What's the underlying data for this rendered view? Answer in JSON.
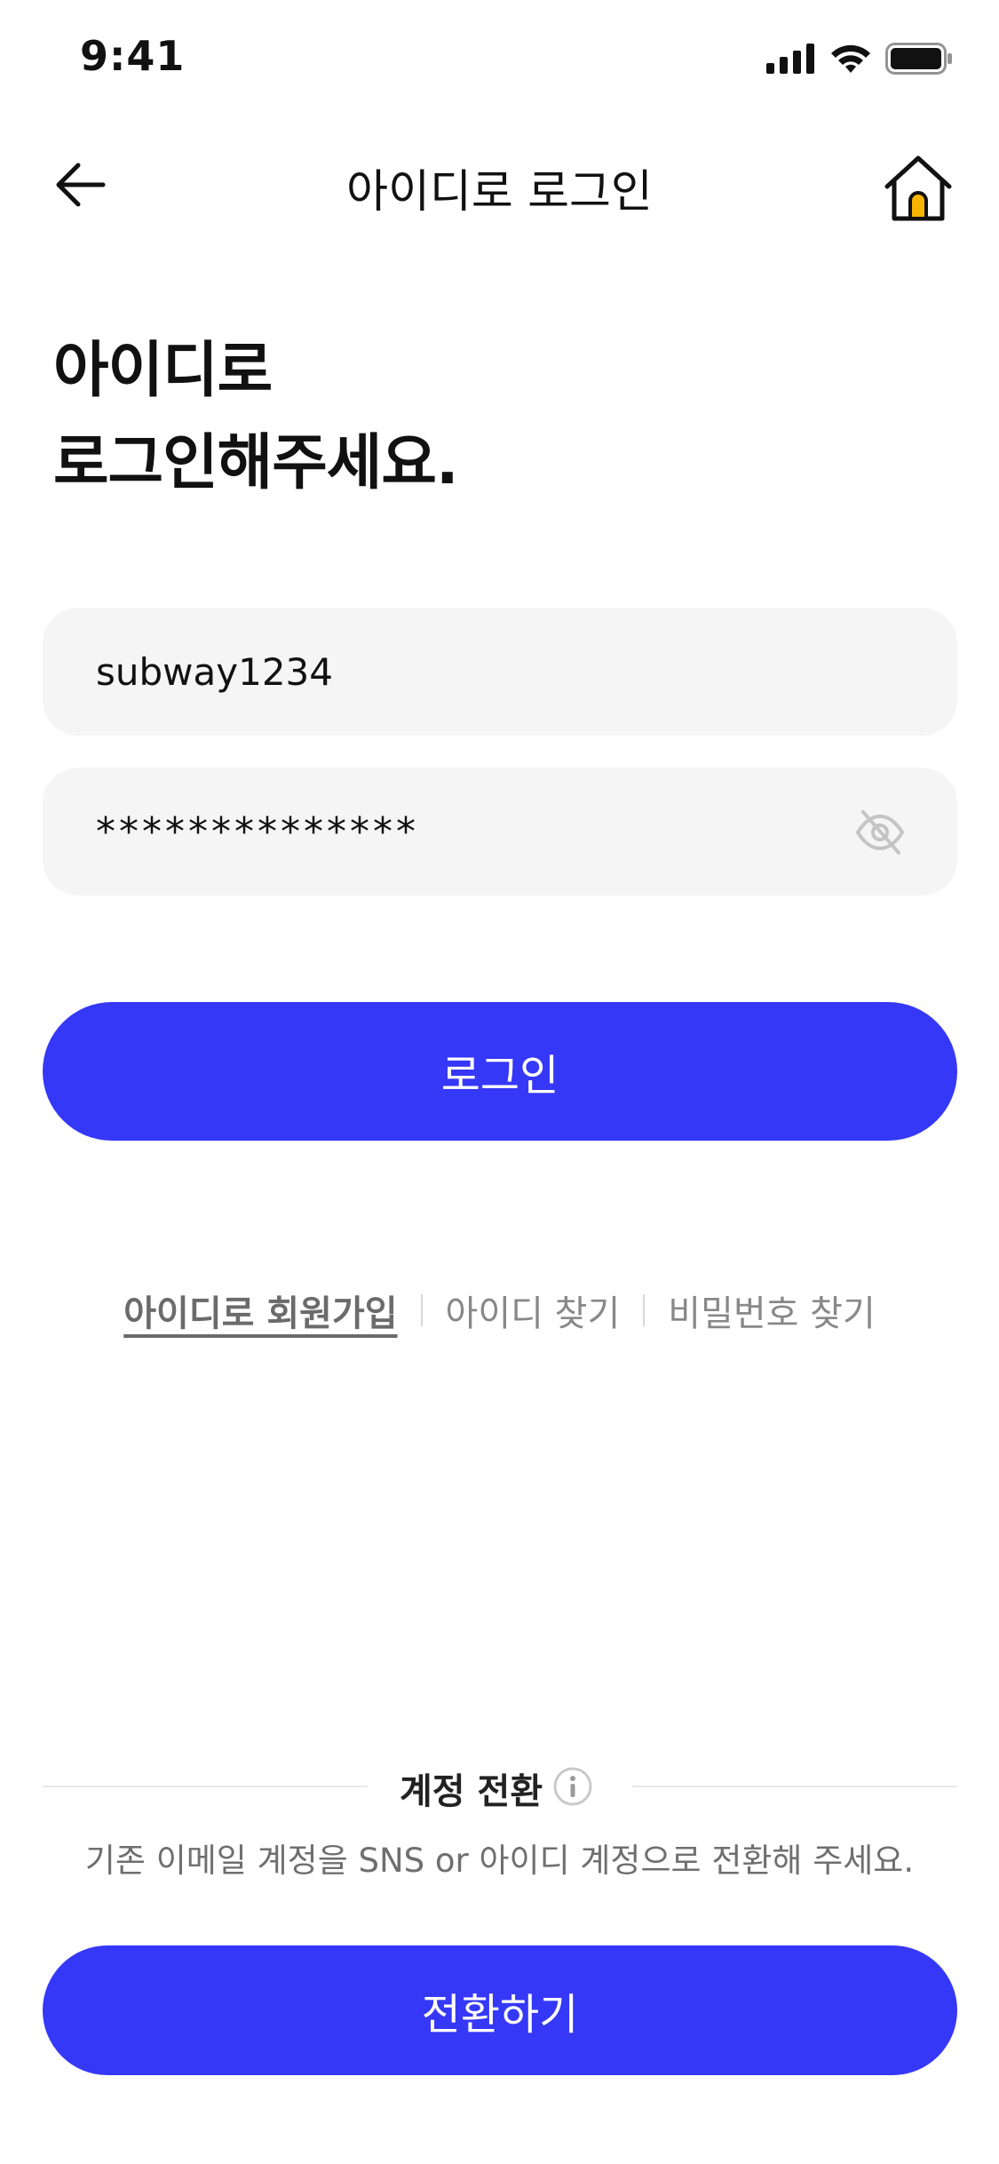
{
  "status_bar": {
    "time": "9:41"
  },
  "nav": {
    "title": "아이디로 로그인",
    "back_icon": "arrow-left-icon",
    "home_icon": "home-icon"
  },
  "heading": {
    "line1": "아이디로",
    "line2": "로그인해주세요."
  },
  "form": {
    "id_value": "subway1234",
    "password_value": "**************",
    "password_toggle_icon": "eye-off-icon"
  },
  "login_button": {
    "label": "로그인"
  },
  "links": {
    "signup": "아이디로 회원가입",
    "find_id": "아이디 찾기",
    "find_password": "비밀번호 찾기"
  },
  "account_conversion": {
    "title": "계정 전환",
    "info_icon": "info-icon",
    "description": "기존 이메일 계정을 SNS or 아이디 계정으로 전환해 주세요.",
    "button_label": "전환하기"
  },
  "colors": {
    "primary": "#3538f7",
    "home_door": "#f7b500",
    "field_bg": "#f5f5f5"
  }
}
